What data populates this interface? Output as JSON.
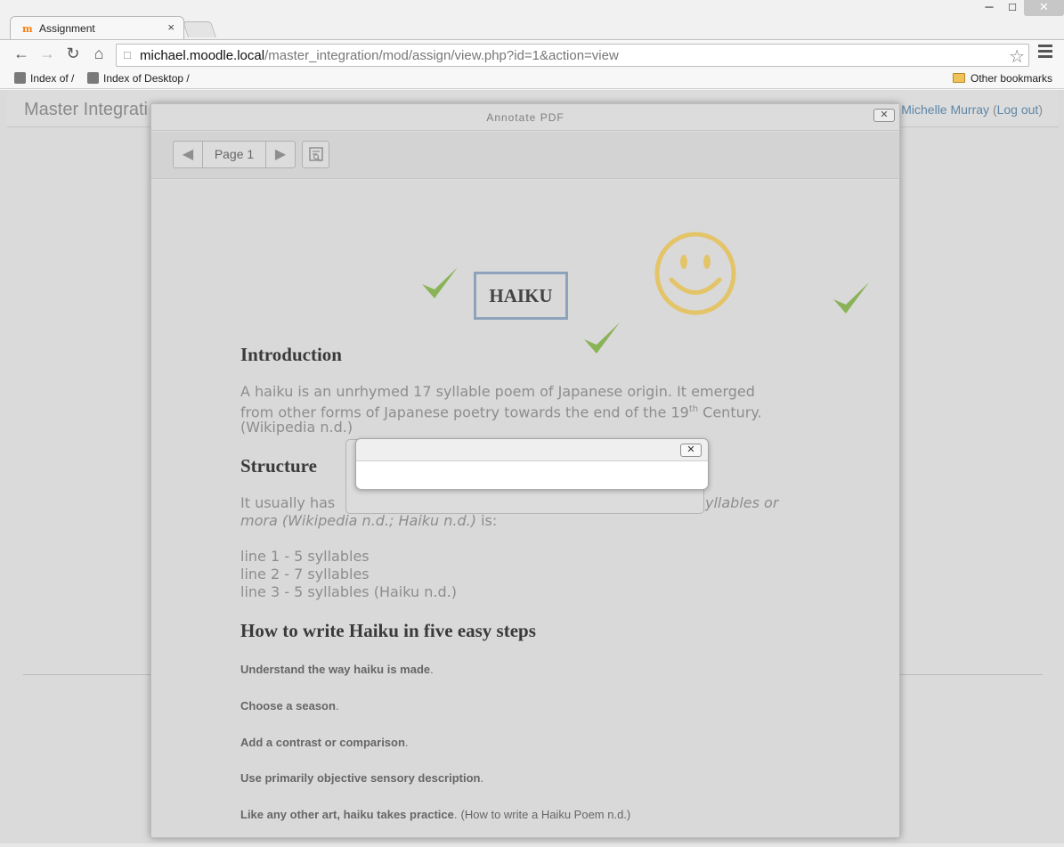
{
  "browser": {
    "tab_title": "Assignment",
    "tab_favicon": "m",
    "tab_close": "×",
    "url_host": "michael.moodle.local",
    "url_path": "/master_integration/mod/assign/view.php?id=1&action=view",
    "bookmarks": [
      "Index of /",
      "Index of Desktop /"
    ],
    "other_bookmarks": "Other bookmarks"
  },
  "site": {
    "name": "Master Integrati",
    "user_name": "Michelle Murray",
    "open_paren": "(",
    "logout": "Log out",
    "close_paren": ")"
  },
  "dialog": {
    "title": "Annotate PDF",
    "close": "✕",
    "page_label": "Page 1",
    "prev": "◀",
    "next": "▶"
  },
  "document": {
    "title": "HAIKU",
    "intro_heading": "Introduction",
    "intro_line1": "A haiku is an unrhymed 17 syllable poem of Japanese origin. It emerged",
    "intro_line2_pre": "from other forms of Japanese poetry towards the end of the 19",
    "intro_line2_sup": "th",
    "intro_line2_post": " Century.",
    "intro_line3": "(Wikipedia n.d.)",
    "structure_heading": "Structure",
    "structure_line1_pre": "It usually has",
    "structure_line1_post": "yllables or",
    "structure_line2_italic": "mora (Wikipedia n.d.; Haiku n.d.)",
    "structure_line2_tail": " is:",
    "lines": [
      "line 1 - 5 syllables",
      "line 2 - 7 syllables",
      "line 3 - 5 syllables (Haiku n.d.)"
    ],
    "steps_heading": "How to write Haiku in five easy steps",
    "steps": [
      {
        "text": "Understand the way haiku is made",
        "end": "."
      },
      {
        "text": "Choose a season",
        "end": "."
      },
      {
        "text": "Add a contrast or comparison",
        "end": "."
      },
      {
        "text": "Use primarily objective sensory description",
        "end": "."
      },
      {
        "text": "Like any other art, haiku takes practice",
        "end": ".",
        "cite": "(How to write a Haiku Poem n.d.)"
      }
    ]
  },
  "popup": {
    "close": "✕"
  },
  "colors": {
    "check_green": "#8ab357",
    "smiley_yellow": "#e3c468",
    "frame_blue": "#8ea2bc",
    "link_blue": "#5d86a8"
  }
}
